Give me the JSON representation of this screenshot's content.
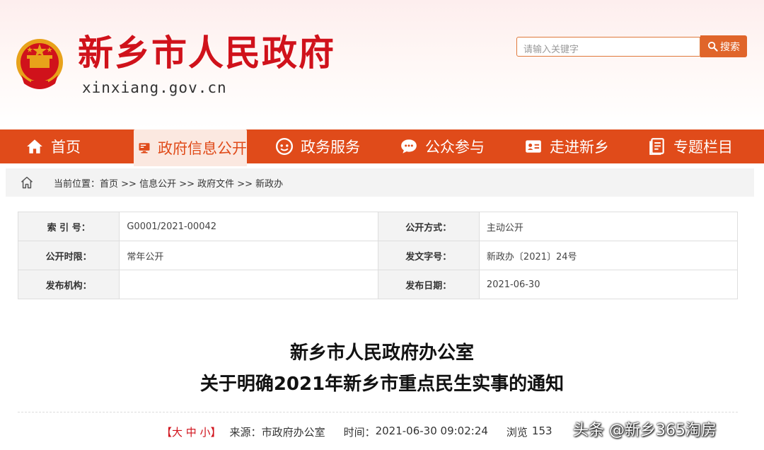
{
  "header": {
    "site_title": "新乡市人民政府",
    "site_domain": "xinxiang.gov.cn",
    "search_placeholder": "请输入关键字",
    "search_label": "搜索"
  },
  "nav": {
    "items": [
      {
        "label": "首页",
        "icon": "home-icon"
      },
      {
        "label": "政府信息公开",
        "icon": "monitor-icon"
      },
      {
        "label": "政务服务",
        "icon": "service-icon"
      },
      {
        "label": "公众参与",
        "icon": "chat-icon"
      },
      {
        "label": "走进新乡",
        "icon": "card-icon"
      },
      {
        "label": "专题栏目",
        "icon": "document-icon"
      }
    ],
    "active_index": 1
  },
  "breadcrumb": {
    "prefix": "当前位置：",
    "trail": "首页 >> 信息公开 >> 政府文件 >> 新政办"
  },
  "info_table": {
    "rows": [
      [
        {
          "k": "索 引 号：",
          "v": "G0001/2021-00042"
        },
        {
          "k": "公开方式：",
          "v": "主动公开"
        }
      ],
      [
        {
          "k": "公开时限：",
          "v": "常年公开"
        },
        {
          "k": "发文字号：",
          "v": "新政办〔2021〕24号"
        }
      ],
      [
        {
          "k": "发布机构：",
          "v": ""
        },
        {
          "k": "发布日期：",
          "v": "2021-06-30"
        }
      ]
    ]
  },
  "article": {
    "title_line1": "新乡市人民政府办公室",
    "title_line2": "关于明确2021年新乡市重点民生实事的通知",
    "font_size_label": "【大 中 小】",
    "source_label": "来源：",
    "source": "市政府办公室",
    "time_label": "时间：",
    "time": "2021-06-30 09:02:24",
    "views_label": "浏览",
    "views": "153"
  },
  "watermark": "头条 @新乡365淘房",
  "colors": {
    "brand_red": "#d0121b",
    "nav_orange": "#e04b1a",
    "search_orange": "#e0652a"
  }
}
